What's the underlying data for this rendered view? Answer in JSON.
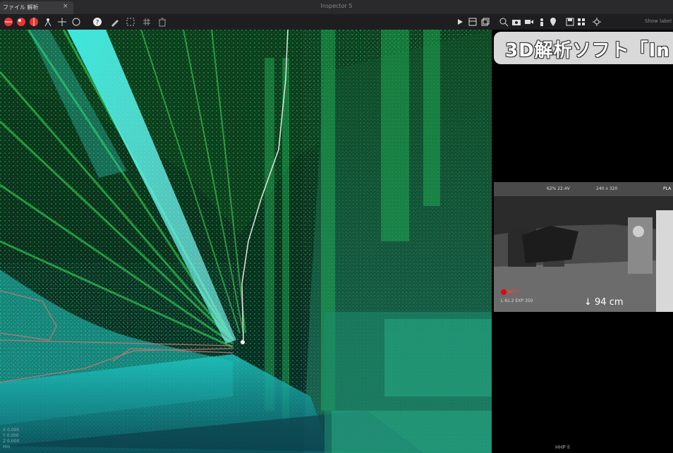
{
  "window": {
    "title": "Inspector 5",
    "tab_label": "ファイル 解析",
    "close_glyph": "×"
  },
  "toolbar": {
    "right_label": "Show label",
    "left_icons": [
      "red-sphere-icon",
      "red-sphere-icon",
      "red-sphere-icon",
      "person-icon",
      "move-icon",
      "rotate-icon",
      "help-icon",
      "pen-icon",
      "select-icon",
      "grid-icon",
      "trash-icon"
    ],
    "right_icons": [
      "play-icon",
      "layers-icon",
      "copy-icon",
      "search-icon",
      "camera-icon",
      "video-icon",
      "person-icon",
      "pin-icon",
      "save-icon",
      "grid-icon",
      "settings-icon"
    ]
  },
  "viewport": {
    "coords_lines": [
      "X  0.000",
      "Y  0.000",
      "Z  0.000",
      "Hm"
    ]
  },
  "right_panel": {
    "banner_text": "3D解析ソフト「In",
    "camera": {
      "status_line_1": "62%  22.4V",
      "status_line_2": "240 x 320",
      "status_badge": "PLA",
      "rec_label": "●REC",
      "info_line": "L 61.2  EXP 350",
      "distance": "↓ 94 cm"
    },
    "footer_text": "HHP  ll"
  },
  "colors": {
    "accent_green": "#22c55e",
    "cloud_cyan": "#2ee6d6",
    "banner_bg": "#d9d9d9",
    "rec_red": "#e00000"
  }
}
